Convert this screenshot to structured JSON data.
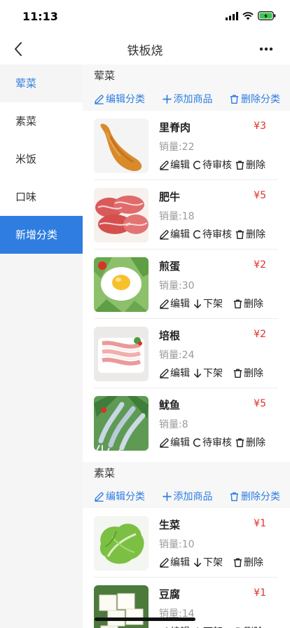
{
  "status": {
    "time": "11:13",
    "icons": [
      "signal-icon",
      "wifi-icon",
      "battery-charging-icon"
    ],
    "battery_color": "#38c74a"
  },
  "nav": {
    "title": "铁板烧",
    "back_icon": "chevron-left-icon",
    "more_icon": "more-horizontal-icon"
  },
  "sidebar": {
    "items": [
      {
        "label": "荤菜"
      },
      {
        "label": "素菜"
      },
      {
        "label": "米饭"
      },
      {
        "label": "口味"
      },
      {
        "label": "新增分类"
      }
    ]
  },
  "colors": {
    "accent": "#2f7de1",
    "price": "#e0312c",
    "muted": "#9a9a9a"
  },
  "categories": [
    {
      "name": "荤菜",
      "actions": {
        "edit": "编辑分类",
        "add": "添加商品",
        "delete": "删除分类"
      },
      "products": [
        {
          "name": "里脊肉",
          "price": "¥3",
          "sales": "销量:22",
          "actions": {
            "edit": "编辑",
            "status": "待审核",
            "delete": "删除"
          }
        },
        {
          "name": "肥牛",
          "price": "¥5",
          "sales": "销量:18",
          "actions": {
            "edit": "编辑",
            "status": "待审核",
            "delete": "删除"
          }
        },
        {
          "name": "煎蛋",
          "price": "¥2",
          "sales": "销量:30",
          "actions": {
            "edit": "编辑",
            "status": "下架",
            "delete": "删除"
          }
        },
        {
          "name": "培根",
          "price": "¥2",
          "sales": "销量:24",
          "actions": {
            "edit": "编辑",
            "status": "下架",
            "delete": "删除"
          }
        },
        {
          "name": "鱿鱼",
          "price": "¥5",
          "sales": "销量:8",
          "actions": {
            "edit": "编辑",
            "status": "待审核",
            "delete": "删除"
          }
        }
      ]
    },
    {
      "name": "素菜",
      "actions": {
        "edit": "编辑分类",
        "add": "添加商品",
        "delete": "删除分类"
      },
      "products": [
        {
          "name": "生菜",
          "price": "¥1",
          "sales": "销量:10",
          "actions": {
            "edit": "编辑",
            "status": "下架",
            "delete": "删除"
          }
        },
        {
          "name": "豆腐",
          "price": "¥1",
          "sales": "销量:14",
          "actions": {
            "edit": "编辑",
            "status": "下架",
            "delete": "删除"
          }
        }
      ]
    }
  ]
}
